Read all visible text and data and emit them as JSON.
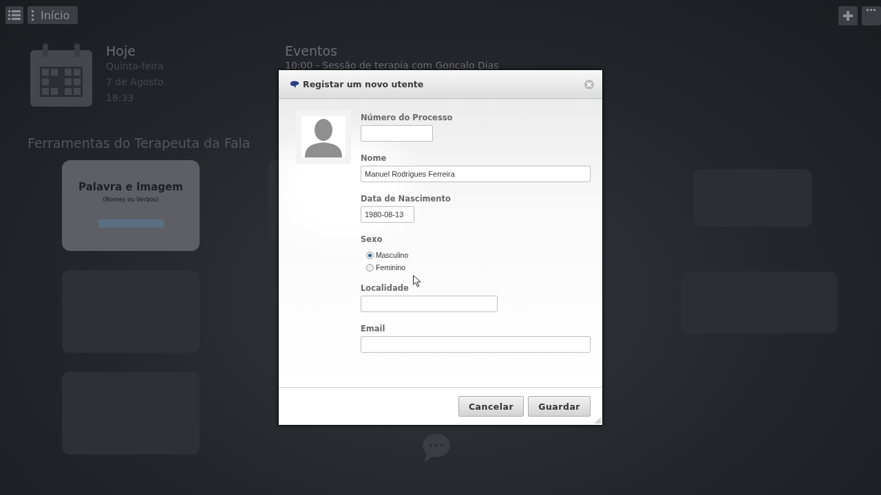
{
  "topbar": {
    "home_button": "Início"
  },
  "today": {
    "title": "Hoje",
    "weekday": "Quinta-feira",
    "date": "7 de Agosto",
    "time": "18:33"
  },
  "events": {
    "title": "Eventos",
    "items": [
      "10:00 - Sessão de terapia com Gonçalo Dias"
    ]
  },
  "tools": {
    "title": "Ferramentas do Terapeuta da Fala",
    "featured": {
      "title": "Palavra e Imagem",
      "subtitle": "(Nomes ou Verbos)"
    }
  },
  "dialog": {
    "title": "Registar um novo utente",
    "fields": [
      {
        "kind": "text",
        "label": "Número do Processo"
      },
      {
        "kind": "text",
        "label": "Nome",
        "value": "Manuel Rodrigues Ferreira"
      },
      {
        "kind": "text",
        "label": "Data de Nascimento",
        "value": "1980-08-13"
      },
      {
        "kind": "radio",
        "label": "Sexo",
        "options": [
          {
            "label": "Masculino",
            "selected": true
          },
          {
            "label": "Feminino",
            "selected": false
          }
        ]
      },
      {
        "kind": "text",
        "label": "Localidade"
      },
      {
        "kind": "text",
        "label": "Email"
      }
    ],
    "buttons": [
      "Cancelar",
      "Guardar"
    ]
  }
}
